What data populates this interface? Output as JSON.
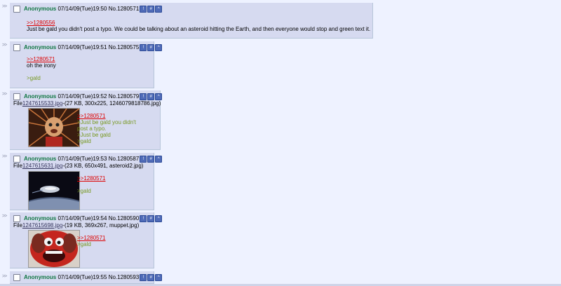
{
  "arrows": ">>",
  "btn_labels": {
    "report": "!",
    "quote": "#",
    "up": "^"
  },
  "posts": [
    {
      "name": "Anonymous",
      "date": "07/14/09(Tue)19:50",
      "number": "No.1280571",
      "lines": [
        {
          "kind": "quote",
          "text": ">>1280556"
        },
        {
          "kind": "text",
          "text": "Just be gald you didn't post a typo. We could be talking about an asteroid hitting the Earth, and then everyone would stop and green text it."
        }
      ]
    },
    {
      "name": "Anonymous",
      "date": "07/14/09(Tue)19:51",
      "number": "No.1280575",
      "lines": [
        {
          "kind": "quote",
          "text": ">>1280571"
        },
        {
          "kind": "text",
          "text": "oh the irony"
        },
        {
          "kind": "gap",
          "text": ""
        },
        {
          "kind": "greentext",
          "text": ">gald"
        }
      ]
    },
    {
      "name": "Anonymous",
      "date": "07/14/09(Tue)19:52",
      "number": "No.1280579",
      "file_prefix": "File",
      "file_link": "1247615533.jpg",
      "file_info": "-(27 KB, 300x225, 1246079818786.jpg)",
      "thumb": "image-thumbnail",
      "lines": [
        {
          "kind": "quote",
          "text": ">>1280571"
        },
        {
          "kind": "greentext",
          "text": ">Just be gald you didn't"
        },
        {
          "kind": "greentext",
          "text": "post a typo."
        },
        {
          "kind": "greentext",
          "text": ">Just be gald"
        },
        {
          "kind": "greentext",
          "text": ">gald"
        }
      ]
    },
    {
      "name": "Anonymous",
      "date": "07/14/09(Tue)19:53",
      "number": "No.1280587",
      "file_prefix": "File",
      "file_link": "1247615631.jpg",
      "file_info": "-(23 KB, 650x491, asteroid2.jpg)",
      "thumb": "asteroid-image",
      "lines": [
        {
          "kind": "quote",
          "text": ">>1280571"
        },
        {
          "kind": "gap",
          "text": ""
        },
        {
          "kind": "greentext",
          "text": ">gald"
        }
      ]
    },
    {
      "name": "Anonymous",
      "date": "07/14/09(Tue)19:54",
      "number": "No.1280590",
      "file_prefix": "File",
      "file_link": "1247615698.jpg",
      "file_info": "-(19 KB, 369x267, muppet.jpg)",
      "thumb": "muppet-image",
      "lines": [
        {
          "kind": "quote",
          "text": ">>1280571"
        },
        {
          "kind": "greentext",
          "text": ">gald"
        }
      ]
    },
    {
      "name": "Anonymous",
      "date": "07/14/09(Tue)19:55",
      "number": "No.1280593",
      "lines": []
    }
  ]
}
